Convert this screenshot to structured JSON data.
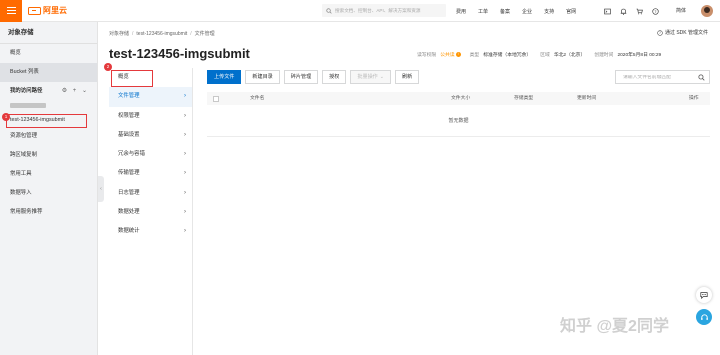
{
  "topbar": {
    "brand": "阿里云",
    "search_placeholder": "搜索文档、控制台、API、解决方案和资源",
    "nav": [
      "费用",
      "工单",
      "备案",
      "企业",
      "支持",
      "官网"
    ],
    "lang": "简体",
    "icons": [
      "terminal-icon",
      "bell-icon",
      "cart-icon",
      "help-icon"
    ]
  },
  "sidebar": {
    "title": "对象存储",
    "items_top": [
      "概览",
      "Bucket 列表"
    ],
    "section_title": "我的访问路径",
    "section_tools": "⚙ + ⌄",
    "bucket_name": "test-123456-imgsubmit",
    "bucket_badge": "1",
    "items_bottom": [
      "资源包管理",
      "跨区域复制",
      "常用工具",
      "数据导入",
      "常用服务推荐"
    ]
  },
  "main": {
    "breadcrumb": [
      "对象存储",
      "test-123456-imgsubmit",
      "文件管理"
    ],
    "sdk_link": "通过 SDK 管理文件",
    "title": "test-123456-imgsubmit",
    "meta": {
      "acl_label": "读写权限",
      "acl_value": "公共读",
      "type_label": "类型",
      "type_value": "标准存储（本地冗余）",
      "region_label": "区域",
      "region_value": "华北2（北京）",
      "created_label": "创建时间",
      "created_value": "2020年5月8日 00:29"
    }
  },
  "subnav": {
    "badge": "2",
    "items": [
      {
        "label": "概览",
        "chevron": ""
      },
      {
        "label": "文件管理",
        "chevron": "›"
      },
      {
        "label": "权限管理",
        "chevron": "›"
      },
      {
        "label": "基础设置",
        "chevron": "›"
      },
      {
        "label": "冗余与容错",
        "chevron": "›"
      },
      {
        "label": "传输管理",
        "chevron": "›"
      },
      {
        "label": "日志管理",
        "chevron": "›"
      },
      {
        "label": "数据处理",
        "chevron": "›"
      },
      {
        "label": "数据统计",
        "chevron": "›"
      }
    ]
  },
  "toolbar": {
    "upload": "上传文件",
    "new_dir": "新建目录",
    "fragments": "碎片管理",
    "authorize": "授权",
    "batch": "批量操作",
    "refresh": "刷新",
    "search_placeholder": "请输入文件名前缀匹配"
  },
  "table": {
    "headers": [
      "文件名",
      "文件大小",
      "存储类型",
      "更新时间",
      "操作"
    ],
    "empty": "暂无数据"
  },
  "watermark": "知乎 @夏2同学",
  "colors": {
    "brand": "#ff6a00",
    "primary": "#0070cc",
    "annotation": "#e4393c",
    "warning": "#ff9500"
  }
}
